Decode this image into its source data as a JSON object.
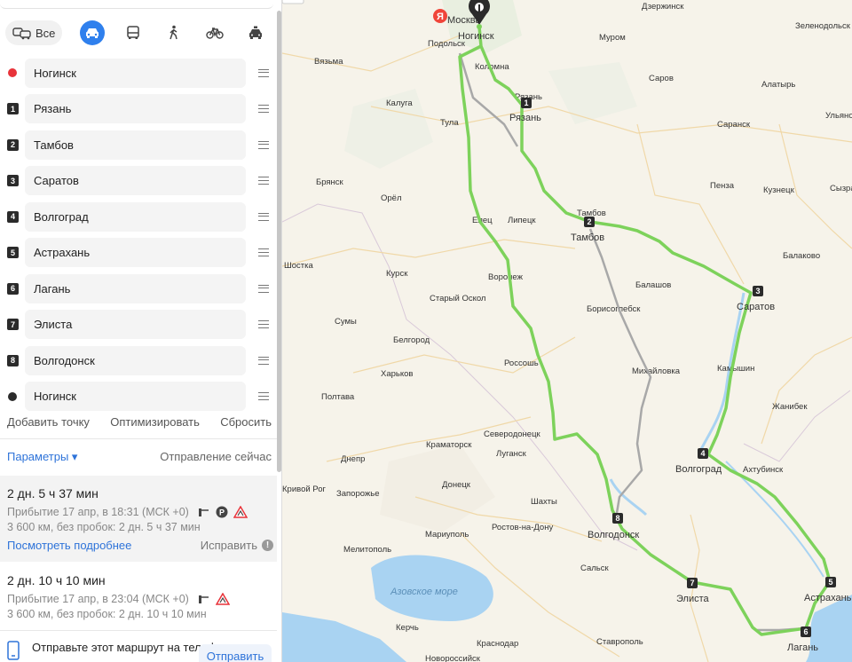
{
  "modes": {
    "all_label": "Все",
    "icons": [
      "car-icon",
      "bus-icon",
      "walking-icon",
      "bicycle-icon",
      "taxi-icon"
    ]
  },
  "points": [
    {
      "marker": "",
      "label": "Ногинск"
    },
    {
      "marker": "1",
      "label": "Рязань"
    },
    {
      "marker": "2",
      "label": "Тамбов"
    },
    {
      "marker": "3",
      "label": "Саратов"
    },
    {
      "marker": "4",
      "label": "Волгоград"
    },
    {
      "marker": "5",
      "label": "Астрахань"
    },
    {
      "marker": "6",
      "label": "Лагань"
    },
    {
      "marker": "7",
      "label": "Элиста"
    },
    {
      "marker": "8",
      "label": "Волгодонск"
    },
    {
      "marker": "",
      "label": "Ногинск"
    }
  ],
  "actions": {
    "add_point": "Добавить точку",
    "optimize": "Оптимизировать",
    "reset": "Сбросить"
  },
  "params": {
    "label": "Параметры ▾",
    "departure": "Отправление сейчас"
  },
  "routes": [
    {
      "time": "2 дн. 5 ч 37 мин",
      "arrival": "Прибытие 17 апр, в 18:31 (МСК +0)",
      "distance": "3 600 км, без пробок: 2 дн. 5 ч 37 мин",
      "details": "Посмотреть подробнее",
      "fix": "Исправить",
      "fix_badge": "!"
    },
    {
      "time": "2 дн. 10 ч 10 мин",
      "arrival": "Прибытие 17 апр, в 23:04 (МСК +0)",
      "distance": "3 600 км, без пробок: 2 дн. 10 ч 10 мин"
    }
  ],
  "send": {
    "text": "Отправьте этот маршрут на телефон",
    "button": "Отправить"
  },
  "colors": {
    "route_main": "#7dd25b",
    "route_alt": "#a8a8a8",
    "link": "#2e73d9",
    "active_mode": "#2f80ed",
    "water": "#a9d3f2"
  },
  "map": {
    "yandex_logo": "Я",
    "sea_label": "Азовское море",
    "route_markers": [
      "1",
      "2",
      "3",
      "4",
      "5",
      "6",
      "7",
      "8"
    ],
    "major_cities": [
      "Москва",
      "Ногинск",
      "Рязань",
      "Тамбов",
      "Саратов",
      "Волгоград",
      "Астрахань",
      "Лагань",
      "Элиста",
      "Волгодонск"
    ],
    "cities": [
      "Дзержинск",
      "Зеленодольск",
      "Подольск",
      "Коломна",
      "Рязань",
      "Муром",
      "Саров",
      "Алатырь",
      "Вязьма",
      "Калуга",
      "Тула",
      "Саранск",
      "Ульянов",
      "Брянск",
      "Пенза",
      "Кузнецк",
      "Сызрань",
      "Орёл",
      "Елец",
      "Липецк",
      "Тамбов",
      "Шостка",
      "Курск",
      "Воронеж",
      "Балашов",
      "Балаково",
      "Старый Оскол",
      "Борисоглебск",
      "Сумы",
      "Белгород",
      "Россошь",
      "Михайловка",
      "Камышин",
      "Полтава",
      "Харьков",
      "Жанибек",
      "Северодонецк",
      "Краматорск",
      "Луганск",
      "Днепр",
      "Ахтубинск",
      "Запорожье",
      "Донецк",
      "Шахты",
      "Мариуполь",
      "Ростов-на-Дону",
      "Сальск",
      "Мелитополь",
      "Керчь",
      "Краснодар",
      "Ставрополь",
      "Новороссийск",
      "Кривой Рог"
    ]
  }
}
